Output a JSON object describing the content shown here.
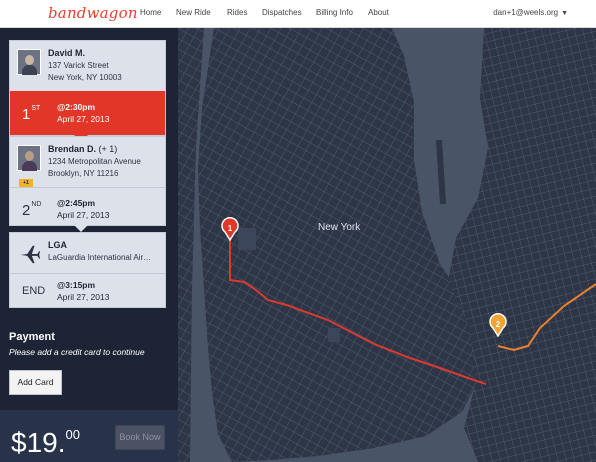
{
  "header": {
    "logo": "bandwagon",
    "nav": [
      "Home",
      "New Ride",
      "Rides",
      "Dispatches",
      "Billing Info",
      "About"
    ],
    "account": "dan+1@weels.org"
  },
  "stops": [
    {
      "name": "David M.",
      "addr1": "137 Varick Street",
      "addr2": "New York, NY 10003",
      "order": "1",
      "order_suffix": "ST",
      "time": "@2:30pm",
      "date": "April 27, 2013"
    },
    {
      "name": "Brendan D.",
      "plus": "(+ 1)",
      "addr1": "1234 Metropolitan Avenue",
      "addr2": "Brooklyn, NY 11216",
      "badge": "+1",
      "order": "2",
      "order_suffix": "ND",
      "time": "@2:45pm",
      "date": "April 27, 2013"
    },
    {
      "name": "LGA",
      "addr1": "LaGuardia International Air…",
      "order": "END",
      "time": "@3:15pm",
      "date": "April 27, 2013"
    }
  ],
  "payment": {
    "title": "Payment",
    "subtitle": "Please add a credit card to continue",
    "add_card": "Add Card"
  },
  "footer": {
    "price_main": "$19.",
    "price_cents": "00",
    "book_now": "Book Now"
  },
  "map": {
    "label": "New York",
    "pins": [
      "1",
      "2"
    ],
    "colors": {
      "water": "#4a5467",
      "land": "#2b3345",
      "route1": "#d93b2f",
      "route2": "#e8822a",
      "pin1": "#e13628",
      "pin2": "#f0a431"
    }
  }
}
